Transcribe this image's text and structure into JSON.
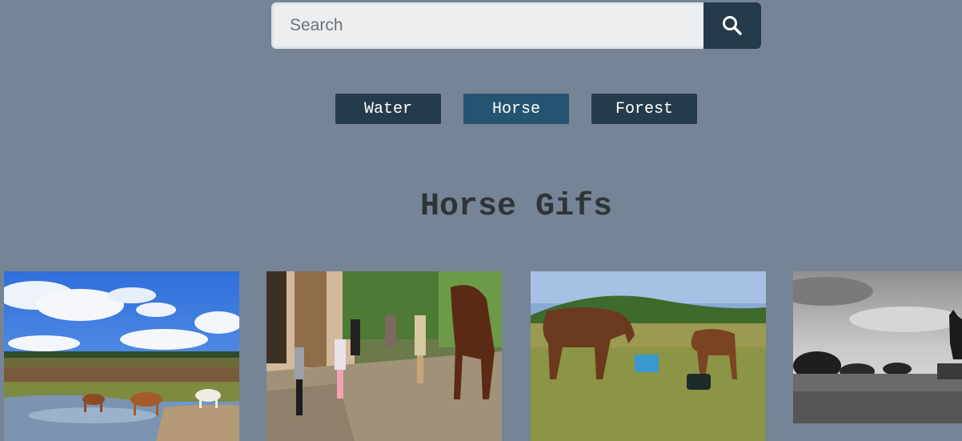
{
  "search": {
    "placeholder": "Search",
    "value": "",
    "button_icon": "search-icon"
  },
  "tags": [
    {
      "label": "Water",
      "active": false
    },
    {
      "label": "Horse",
      "active": true
    },
    {
      "label": "Forest",
      "active": false
    }
  ],
  "heading": "Horse Gifs",
  "gifs": [
    {
      "subject": "wild ponies drinking at a pond under blue sky"
    },
    {
      "subject": "children playing next to a brown horse at a stable"
    },
    {
      "subject": "brown horse and foal grazing in a meadow"
    },
    {
      "subject": "black and white horse and rider statue"
    }
  ],
  "colors": {
    "background": "#758596",
    "button_dark": "#253b4b",
    "button_active": "#255472",
    "heading": "#2f3437"
  }
}
